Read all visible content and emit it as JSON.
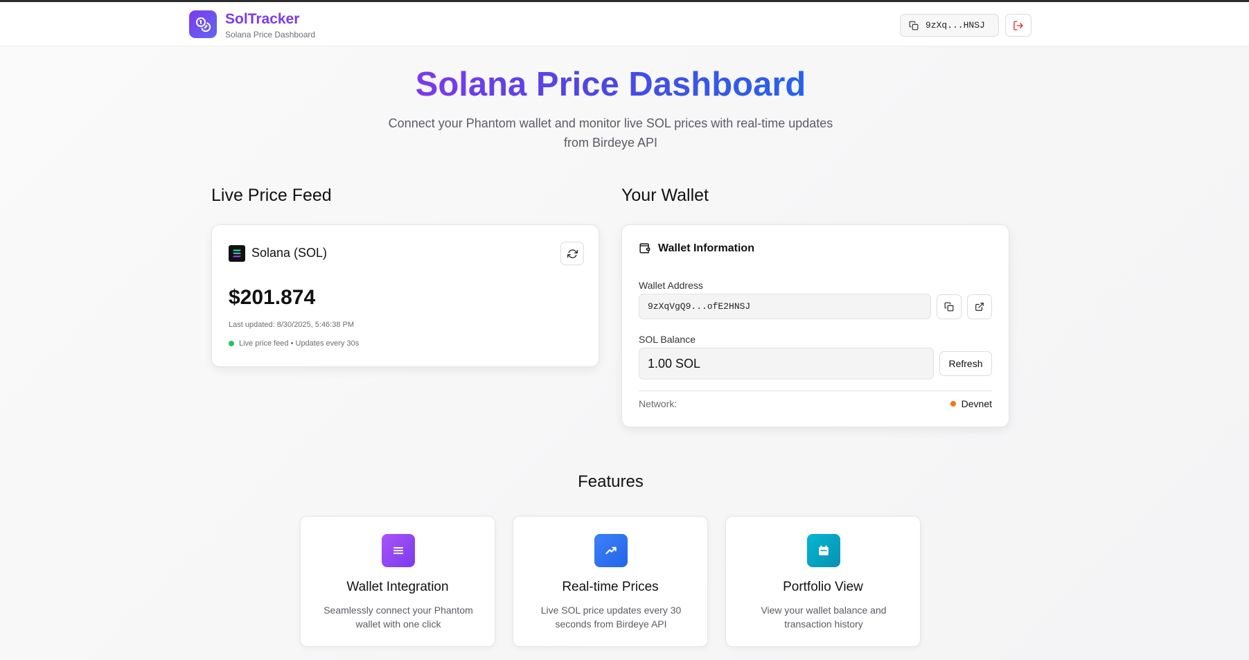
{
  "header": {
    "brand_title": "SolTracker",
    "brand_subtitle": "Solana Price Dashboard",
    "short_address": "9zXq...HNSJ"
  },
  "hero": {
    "title": "Solana Price Dashboard",
    "subtitle_line1": "Connect your Phantom wallet and monitor live SOL prices with real-time updates",
    "subtitle_line2": "from Birdeye API"
  },
  "price_section": {
    "heading": "Live Price Feed",
    "token_name": "Solana (SOL)",
    "price": "$201.874",
    "last_updated": "Last updated: 8/30/2025, 5:46:38 PM",
    "status": "Live price feed • Updates every 30s"
  },
  "wallet_section": {
    "heading": "Your Wallet",
    "card_title": "Wallet Information",
    "address_label": "Wallet Address",
    "address_value": "9zXqVgQ9...ofE2HNSJ",
    "balance_label": "SOL Balance",
    "balance_value": "1.00 SOL",
    "refresh_label": "Refresh",
    "network_label": "Network:",
    "network_value": "Devnet"
  },
  "features": {
    "heading": "Features",
    "items": [
      {
        "title": "Wallet Integration",
        "desc_line1": "Seamlessly connect your Phantom",
        "desc_line2": "wallet with one click",
        "icon": "list-icon"
      },
      {
        "title": "Real-time Prices",
        "desc_line1": "Live SOL price updates every 30",
        "desc_line2": "seconds from Birdeye API",
        "icon": "trending-up-icon"
      },
      {
        "title": "Portfolio View",
        "desc_line1": "View your wallet balance and",
        "desc_line2": "transaction history",
        "icon": "calendar-icon"
      }
    ]
  },
  "colors": {
    "brand_purple": "#7c3aed",
    "title_blue": "#2563eb",
    "live_dot": "#22c55e",
    "network_dot": "#f97316",
    "logout_red": "#dc2626"
  }
}
